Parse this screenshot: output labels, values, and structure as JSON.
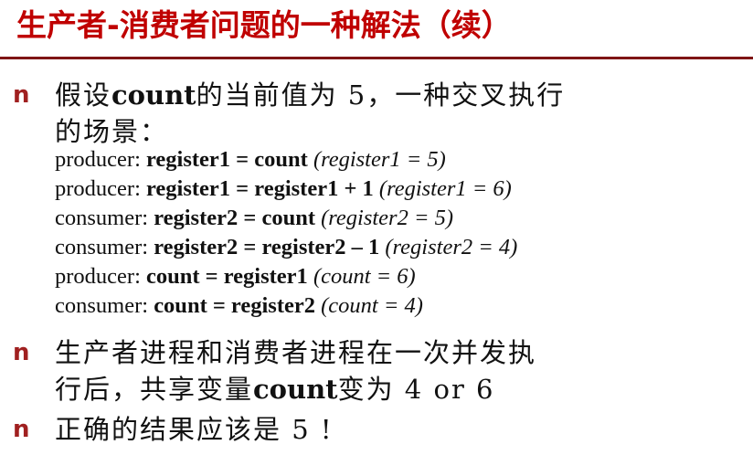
{
  "title": "生产者-消费者问题的一种解法（续）",
  "bullets": [
    {
      "marker": "n",
      "line1_pre": "假设",
      "line1_bold": "count",
      "line1_post": "的当前值为 5，一种交叉执行",
      "line2": "的场景："
    },
    {
      "marker": "n",
      "line1": "生产者进程和消费者进程在一次并发执",
      "line2_pre": "行后，共享变量",
      "line2_bold": "count",
      "line2_post": "变为 4 or 6"
    },
    {
      "marker": "n",
      "line1": "正确的结果应该是 5 !"
    }
  ],
  "steps": [
    {
      "who": "producer: ",
      "stmt": "register1 = count",
      "note": "(register1 = 5)"
    },
    {
      "who": "producer: ",
      "stmt": "register1 = register1 + 1",
      "note": "(register1 = 6)"
    },
    {
      "who": "consumer: ",
      "stmt": "register2 = count",
      "note": "(register2 = 5)"
    },
    {
      "who": "consumer: ",
      "stmt": "register2 = register2 – 1",
      "note": "(register2 = 4)"
    },
    {
      "who": "producer: ",
      "stmt": "count = register1",
      "note": "(count = 6)"
    },
    {
      "who": "consumer: ",
      "stmt": "count = register2",
      "note": "(count = 4)"
    }
  ]
}
